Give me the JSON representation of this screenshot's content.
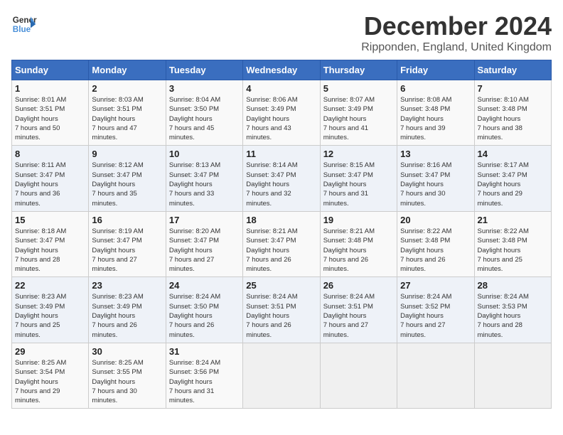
{
  "header": {
    "logo_line1": "General",
    "logo_line2": "Blue",
    "title": "December 2024",
    "subtitle": "Ripponden, England, United Kingdom"
  },
  "days_of_week": [
    "Sunday",
    "Monday",
    "Tuesday",
    "Wednesday",
    "Thursday",
    "Friday",
    "Saturday"
  ],
  "weeks": [
    [
      {
        "day": "1",
        "sunrise": "8:01 AM",
        "sunset": "3:51 PM",
        "daylight": "7 hours and 50 minutes."
      },
      {
        "day": "2",
        "sunrise": "8:03 AM",
        "sunset": "3:51 PM",
        "daylight": "7 hours and 47 minutes."
      },
      {
        "day": "3",
        "sunrise": "8:04 AM",
        "sunset": "3:50 PM",
        "daylight": "7 hours and 45 minutes."
      },
      {
        "day": "4",
        "sunrise": "8:06 AM",
        "sunset": "3:49 PM",
        "daylight": "7 hours and 43 minutes."
      },
      {
        "day": "5",
        "sunrise": "8:07 AM",
        "sunset": "3:49 PM",
        "daylight": "7 hours and 41 minutes."
      },
      {
        "day": "6",
        "sunrise": "8:08 AM",
        "sunset": "3:48 PM",
        "daylight": "7 hours and 39 minutes."
      },
      {
        "day": "7",
        "sunrise": "8:10 AM",
        "sunset": "3:48 PM",
        "daylight": "7 hours and 38 minutes."
      }
    ],
    [
      {
        "day": "8",
        "sunrise": "8:11 AM",
        "sunset": "3:47 PM",
        "daylight": "7 hours and 36 minutes."
      },
      {
        "day": "9",
        "sunrise": "8:12 AM",
        "sunset": "3:47 PM",
        "daylight": "7 hours and 35 minutes."
      },
      {
        "day": "10",
        "sunrise": "8:13 AM",
        "sunset": "3:47 PM",
        "daylight": "7 hours and 33 minutes."
      },
      {
        "day": "11",
        "sunrise": "8:14 AM",
        "sunset": "3:47 PM",
        "daylight": "7 hours and 32 minutes."
      },
      {
        "day": "12",
        "sunrise": "8:15 AM",
        "sunset": "3:47 PM",
        "daylight": "7 hours and 31 minutes."
      },
      {
        "day": "13",
        "sunrise": "8:16 AM",
        "sunset": "3:47 PM",
        "daylight": "7 hours and 30 minutes."
      },
      {
        "day": "14",
        "sunrise": "8:17 AM",
        "sunset": "3:47 PM",
        "daylight": "7 hours and 29 minutes."
      }
    ],
    [
      {
        "day": "15",
        "sunrise": "8:18 AM",
        "sunset": "3:47 PM",
        "daylight": "7 hours and 28 minutes."
      },
      {
        "day": "16",
        "sunrise": "8:19 AM",
        "sunset": "3:47 PM",
        "daylight": "7 hours and 27 minutes."
      },
      {
        "day": "17",
        "sunrise": "8:20 AM",
        "sunset": "3:47 PM",
        "daylight": "7 hours and 27 minutes."
      },
      {
        "day": "18",
        "sunrise": "8:21 AM",
        "sunset": "3:47 PM",
        "daylight": "7 hours and 26 minutes."
      },
      {
        "day": "19",
        "sunrise": "8:21 AM",
        "sunset": "3:48 PM",
        "daylight": "7 hours and 26 minutes."
      },
      {
        "day": "20",
        "sunrise": "8:22 AM",
        "sunset": "3:48 PM",
        "daylight": "7 hours and 26 minutes."
      },
      {
        "day": "21",
        "sunrise": "8:22 AM",
        "sunset": "3:48 PM",
        "daylight": "7 hours and 25 minutes."
      }
    ],
    [
      {
        "day": "22",
        "sunrise": "8:23 AM",
        "sunset": "3:49 PM",
        "daylight": "7 hours and 25 minutes."
      },
      {
        "day": "23",
        "sunrise": "8:23 AM",
        "sunset": "3:49 PM",
        "daylight": "7 hours and 26 minutes."
      },
      {
        "day": "24",
        "sunrise": "8:24 AM",
        "sunset": "3:50 PM",
        "daylight": "7 hours and 26 minutes."
      },
      {
        "day": "25",
        "sunrise": "8:24 AM",
        "sunset": "3:51 PM",
        "daylight": "7 hours and 26 minutes."
      },
      {
        "day": "26",
        "sunrise": "8:24 AM",
        "sunset": "3:51 PM",
        "daylight": "7 hours and 27 minutes."
      },
      {
        "day": "27",
        "sunrise": "8:24 AM",
        "sunset": "3:52 PM",
        "daylight": "7 hours and 27 minutes."
      },
      {
        "day": "28",
        "sunrise": "8:24 AM",
        "sunset": "3:53 PM",
        "daylight": "7 hours and 28 minutes."
      }
    ],
    [
      {
        "day": "29",
        "sunrise": "8:25 AM",
        "sunset": "3:54 PM",
        "daylight": "7 hours and 29 minutes."
      },
      {
        "day": "30",
        "sunrise": "8:25 AM",
        "sunset": "3:55 PM",
        "daylight": "7 hours and 30 minutes."
      },
      {
        "day": "31",
        "sunrise": "8:24 AM",
        "sunset": "3:56 PM",
        "daylight": "7 hours and 31 minutes."
      },
      null,
      null,
      null,
      null
    ]
  ]
}
